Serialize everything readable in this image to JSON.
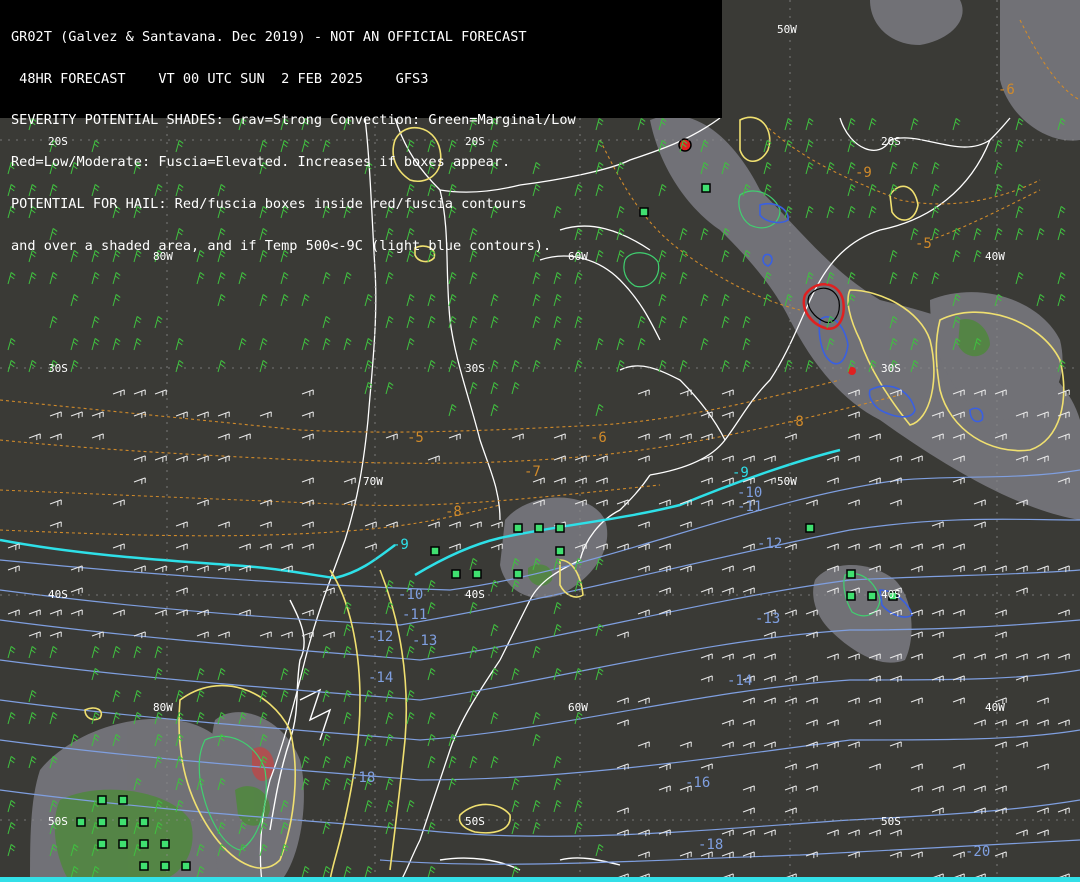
{
  "header": {
    "line1": "GR02T (Galvez & Santavana. Dec 2019) - NOT AN OFFICIAL FORECAST",
    "line2": " 48HR FORECAST    VT 00 UTC SUN  2 FEB 2025    GFS3",
    "line3": "SEVERITY POTENTIAL SHADES: Grav=Strong Convection: Green=Marginal/Low",
    "line4": "Red=Low/Moderate: Fuscia=Elevated. Increases if boxes appear.",
    "line5": "POTENTIAL FOR HAIL: Red/fuscia boxes inside red/fuscia contours",
    "line6": "and over a shaded area, and if Temp 500<-9C (light blue contours)."
  },
  "grid_labels": [
    {
      "text": "50W",
      "id": "lon-50w-top"
    },
    {
      "text": "20S",
      "id": "lat-20s-a"
    },
    {
      "text": "20S",
      "id": "lat-20s-b"
    },
    {
      "text": "20S",
      "id": "lat-20s-c"
    },
    {
      "text": "80W",
      "id": "lon-80w-a"
    },
    {
      "text": "60W",
      "id": "lon-60w-a"
    },
    {
      "text": "40W",
      "id": "lon-40w-a"
    },
    {
      "text": "30S",
      "id": "lat-30s-a"
    },
    {
      "text": "30S",
      "id": "lat-30s-b"
    },
    {
      "text": "30S",
      "id": "lat-30s-c"
    },
    {
      "text": "70W",
      "id": "lon-70w"
    },
    {
      "text": "50W",
      "id": "lon-50w-mid"
    },
    {
      "text": "40S",
      "id": "lat-40s-a"
    },
    {
      "text": "40S",
      "id": "lat-40s-b"
    },
    {
      "text": "40S",
      "id": "lat-40s-c"
    },
    {
      "text": "80W",
      "id": "lon-80w-b"
    },
    {
      "text": "60W",
      "id": "lon-60w-b"
    },
    {
      "text": "40W",
      "id": "lon-40w-b"
    },
    {
      "text": "50S",
      "id": "lat-50s-a"
    },
    {
      "text": "50S",
      "id": "lat-50s-b"
    },
    {
      "text": "50S",
      "id": "lat-50s-c"
    }
  ],
  "temp_labels": [
    {
      "text": "-5",
      "kind": "orange"
    },
    {
      "text": "-6",
      "kind": "orange"
    },
    {
      "text": "-7",
      "kind": "orange"
    },
    {
      "text": "-8",
      "kind": "orange"
    },
    {
      "text": "-8",
      "kind": "orange"
    },
    {
      "text": "-5",
      "kind": "orange"
    },
    {
      "text": "-9",
      "kind": "orange"
    },
    {
      "text": "-6",
      "kind": "orange"
    },
    {
      "text": "-9",
      "kind": "cyan"
    },
    {
      "text": "-9",
      "kind": "cyan"
    },
    {
      "text": "-10",
      "kind": "blue"
    },
    {
      "text": "-11",
      "kind": "blue"
    },
    {
      "text": "-12",
      "kind": "blue"
    },
    {
      "text": "-13",
      "kind": "blue"
    },
    {
      "text": "-14",
      "kind": "blue"
    },
    {
      "text": "-16",
      "kind": "blue"
    },
    {
      "text": "-18",
      "kind": "blue"
    },
    {
      "text": "-10",
      "kind": "blue"
    },
    {
      "text": "-11",
      "kind": "blue"
    },
    {
      "text": "-12",
      "kind": "blue"
    },
    {
      "text": "-13",
      "kind": "blue"
    },
    {
      "text": "-14",
      "kind": "blue"
    },
    {
      "text": "-18",
      "kind": "blue"
    },
    {
      "text": "-20",
      "kind": "blue"
    }
  ],
  "colors": {
    "background": "#3a3a36",
    "coastline": "#ffffff",
    "shade_gray": "#7a7a80",
    "shade_green": "#4f8a3a",
    "shade_red": "#b84a4a",
    "cyan_contour": "#2ee0e8",
    "blue_contour": "#7f9fe0",
    "orange_contour": "#d08a2a",
    "yellow_contour": "#f0e070",
    "green_box": "#40e070",
    "wind_green": "#40c040",
    "wind_white": "#e8e8e8"
  }
}
